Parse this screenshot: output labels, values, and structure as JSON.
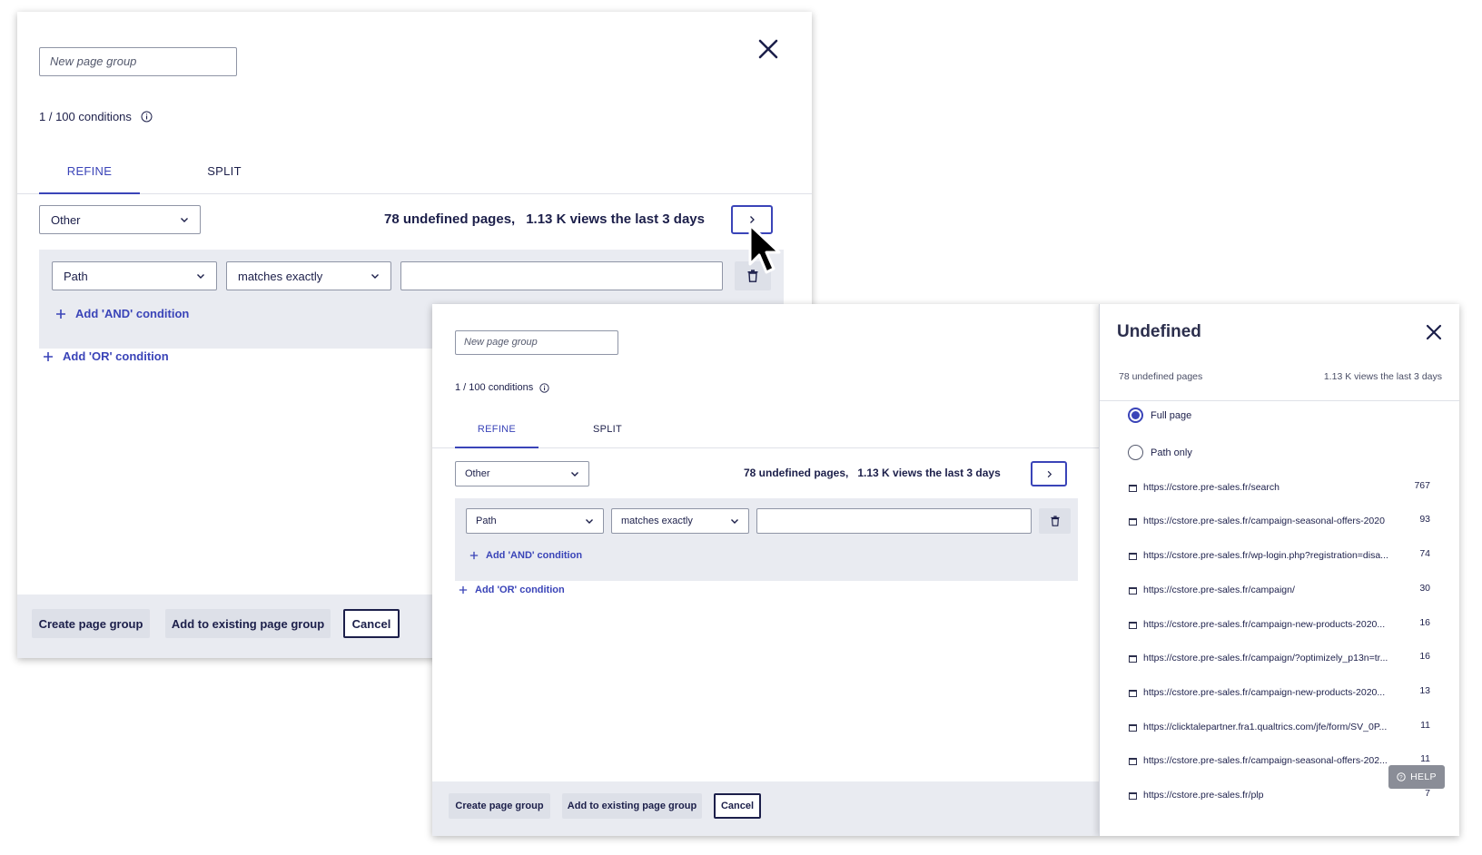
{
  "back_dialog": {
    "name_placeholder": "New page group",
    "conditions_count": "1 / 100 conditions",
    "tabs": [
      "REFINE",
      "SPLIT"
    ],
    "group_select": "Other",
    "summary_pages": "78 undefined pages,",
    "summary_views": "1.13 K views the last 3 days",
    "field_select": "Path",
    "operator_select": "matches exactly",
    "value": "",
    "add_and": "Add 'AND' condition",
    "add_or": "Add 'OR' condition",
    "footer": {
      "create": "Create page group",
      "add_existing": "Add to existing page group",
      "cancel": "Cancel"
    }
  },
  "front_dialog": {
    "name_placeholder": "New page group",
    "conditions_count": "1 / 100 conditions",
    "tabs": [
      "REFINE",
      "SPLIT"
    ],
    "group_select": "Other",
    "summary_pages": "78 undefined pages,",
    "summary_views": "1.13 K views the last 3 days",
    "field_select": "Path",
    "operator_select": "matches exactly",
    "value": "",
    "add_and": "Add 'AND' condition",
    "add_or": "Add 'OR' condition",
    "footer": {
      "create": "Create page group",
      "add_existing": "Add to existing page group",
      "cancel": "Cancel"
    }
  },
  "drawer": {
    "title": "Undefined",
    "pages_stat": "78 undefined pages",
    "views_stat": "1.13 K views the last 3 days",
    "radio_full": "Full page",
    "radio_path": "Path only",
    "selected": "Full page",
    "rows": [
      {
        "url": "https://cstore.pre-sales.fr/search",
        "count": "767"
      },
      {
        "url": "https://cstore.pre-sales.fr/campaign-seasonal-offers-2020",
        "count": "93"
      },
      {
        "url": "https://cstore.pre-sales.fr/wp-login.php?registration=disa...",
        "count": "74"
      },
      {
        "url": "https://cstore.pre-sales.fr/campaign/",
        "count": "30"
      },
      {
        "url": "https://cstore.pre-sales.fr/campaign-new-products-2020...",
        "count": "16"
      },
      {
        "url": "https://cstore.pre-sales.fr/campaign/?optimizely_p13n=tr...",
        "count": "16"
      },
      {
        "url": "https://cstore.pre-sales.fr/campaign-new-products-2020...",
        "count": "13"
      },
      {
        "url": "https://clicktalepartner.fra1.qualtrics.com/jfe/form/SV_0P...",
        "count": "11"
      },
      {
        "url": "https://cstore.pre-sales.fr/campaign-seasonal-offers-202...",
        "count": "11"
      },
      {
        "url": "https://cstore.pre-sales.fr/plp",
        "count": "7"
      }
    ],
    "help": "HELP"
  },
  "icons": {
    "close": "close-icon",
    "info": "info-icon",
    "chevron": "chevron-down-icon",
    "next": "chevron-right-icon",
    "trash": "trash-icon",
    "plus": "plus-icon",
    "page": "page-icon",
    "cursor": "mouse-pointer-icon",
    "help": "help-circle-icon"
  },
  "colors": {
    "accent": "#3a44b8",
    "text": "#1c1f4a",
    "panel_gray": "#e9ebf1",
    "help_bg": "#8a8d97"
  }
}
